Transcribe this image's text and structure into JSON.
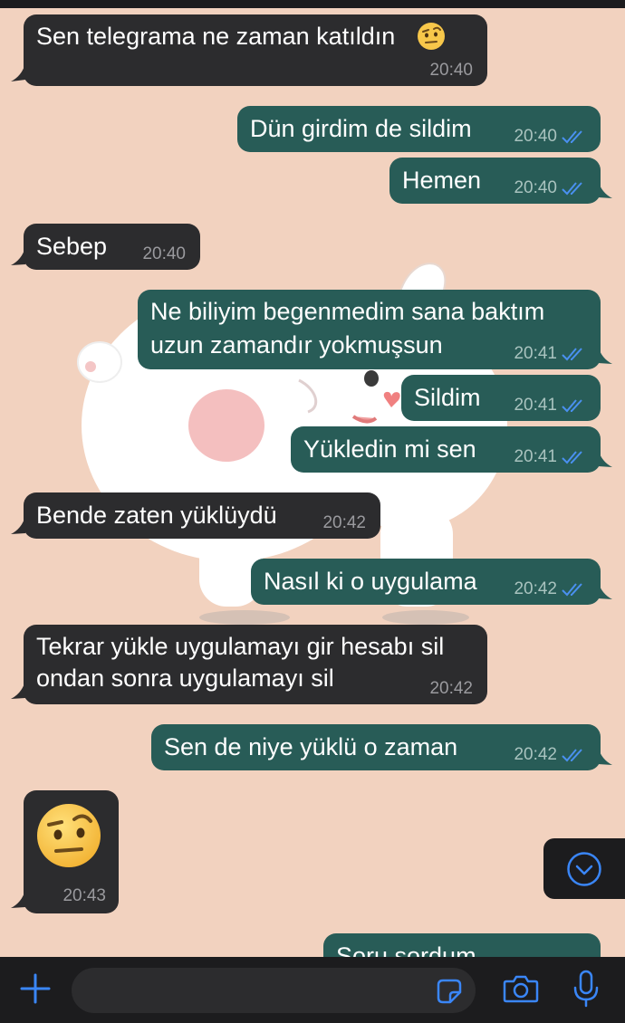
{
  "messages": [
    {
      "text": "Sen telegrama ne zaman katıldın",
      "emoji": "face-with-raised-eyebrow",
      "time": "20:40",
      "dir": "in"
    },
    {
      "text": "Dün girdim de sildim",
      "time": "20:40",
      "dir": "out"
    },
    {
      "text": "Hemen",
      "time": "20:40",
      "dir": "out"
    },
    {
      "text": "Sebep",
      "time": "20:40",
      "dir": "in"
    },
    {
      "line1": "Ne biliyim begenmedim sana baktım",
      "line2": "uzun zamandır yokmuşsun",
      "time": "20:41",
      "dir": "out"
    },
    {
      "text": "Sildim",
      "time": "20:41",
      "dir": "out"
    },
    {
      "text": "Yükledin mi sen",
      "time": "20:41",
      "dir": "out"
    },
    {
      "text": "Bende zaten yüklüydü",
      "time": "20:42",
      "dir": "in"
    },
    {
      "text": "Nasıl ki o uygulama",
      "time": "20:42",
      "dir": "out"
    },
    {
      "line1": "Tekrar yükle uygulamayı gir hesabı sil",
      "line2": "ondan sonra uygulamayı sil",
      "time": "20:42",
      "dir": "in"
    },
    {
      "text": "Sen de niye yüklü o zaman",
      "time": "20:42",
      "dir": "out"
    },
    {
      "emoji": "face-with-raised-eyebrow",
      "time": "20:43",
      "dir": "in"
    },
    {
      "text": "Soru sordum",
      "dir": "out",
      "partial": true
    }
  ],
  "colors": {
    "wallpaper": "#f2d2bf",
    "incoming_bubble": "#2c2c2e",
    "outgoing_bubble": "#285c57",
    "read_ticks": "#4a90f0",
    "accent": "#3a86f7"
  },
  "icons": {
    "scroll_down": "chevron-down-circle-icon",
    "attach": "plus-icon",
    "sticker": "sticker-icon",
    "camera": "camera-icon",
    "microphone": "microphone-icon"
  }
}
